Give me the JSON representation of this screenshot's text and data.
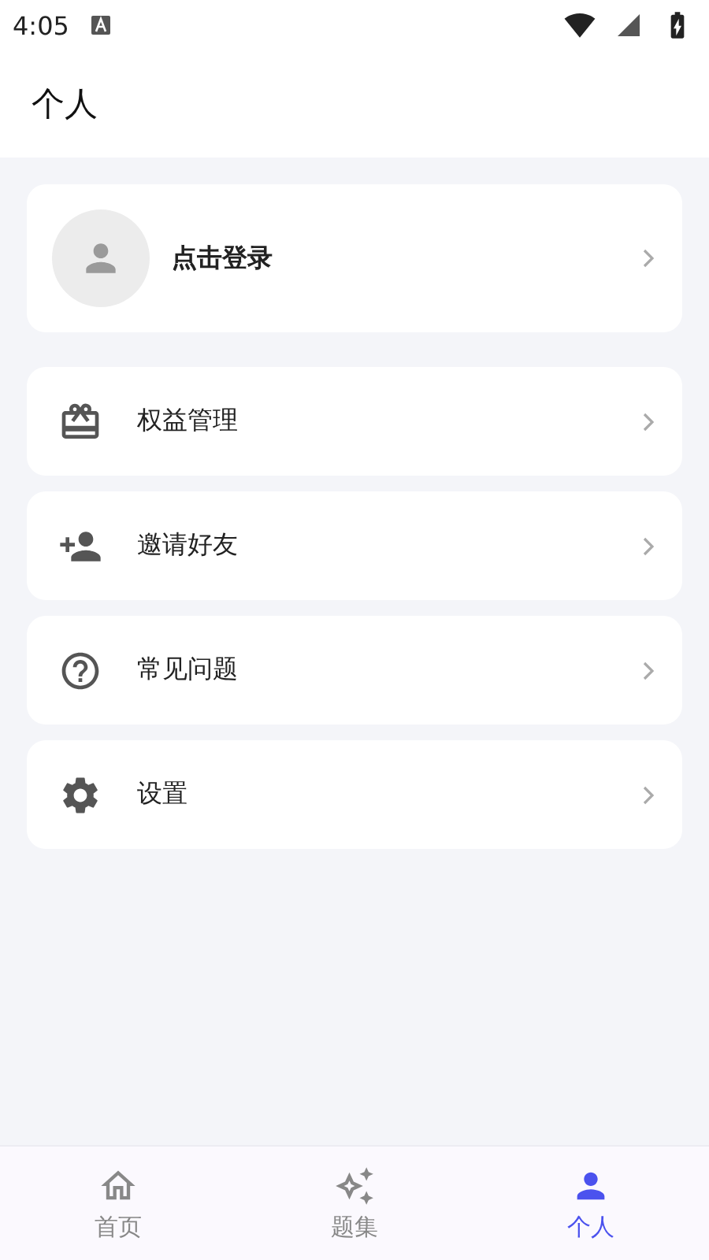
{
  "status_bar": {
    "time": "4:05"
  },
  "header": {
    "title": "个人"
  },
  "login_card": {
    "label": "点击登录"
  },
  "menu": [
    {
      "label": "权益管理"
    },
    {
      "label": "邀请好友"
    },
    {
      "label": "常见问题"
    },
    {
      "label": "设置"
    }
  ],
  "tabs": [
    {
      "label": "首页",
      "selected": false
    },
    {
      "label": "题集",
      "selected": false
    },
    {
      "label": "个人",
      "selected": true
    }
  ]
}
